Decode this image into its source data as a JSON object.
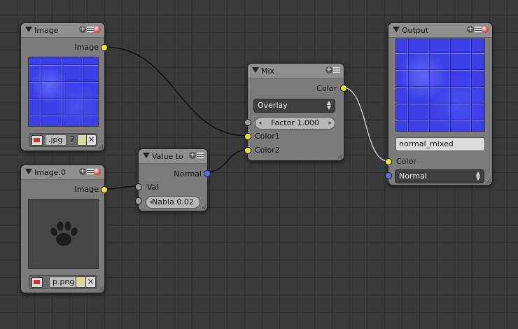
{
  "nodes": {
    "image": {
      "title": "Image",
      "output_label": "Image",
      "filename": ".jpg",
      "users": "2"
    },
    "image0": {
      "title": "Image.0",
      "output_label": "Image",
      "filename": "p.png"
    },
    "value_to": {
      "title": "Value to",
      "output_label": "Normal",
      "input_label": "Val",
      "nabla_field": "Nabla 0.02"
    },
    "mix": {
      "title": "Mix",
      "output_label": "Color",
      "blend_mode": "Overlay",
      "factor_field": "Factor 1.000",
      "input1_label": "Color1",
      "input2_label": "Color2"
    },
    "output": {
      "title": "Output",
      "name_field": "normal_mixed",
      "color_label": "Color",
      "normal_dropdown": "Normal"
    }
  },
  "colors": {
    "socket_color": "#e7e72e",
    "socket_vector": "#6468e0",
    "socket_value": "#a0a0a0",
    "link": "#111111",
    "link_selected": "#d8d8d8"
  }
}
